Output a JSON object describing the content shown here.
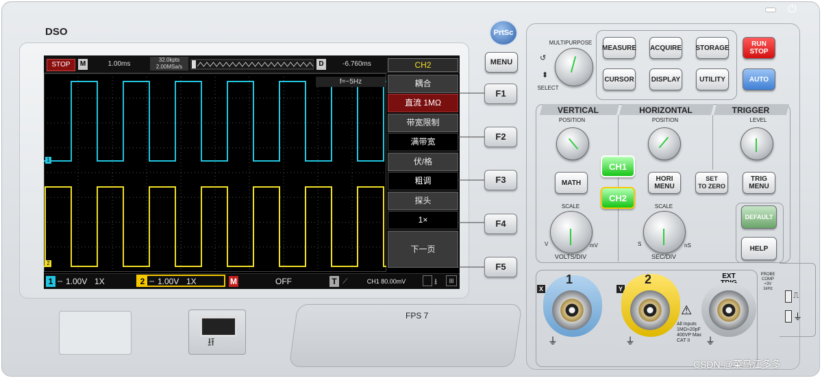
{
  "brand": "DSO",
  "screen": {
    "topbar": {
      "run_state": "STOP",
      "mode_badge": "M",
      "timebase": "1.00ms",
      "memory": "32.0kpts",
      "sample_rate": "2.00MSa/s",
      "delay_badge": "D",
      "delay": "-6.760ms",
      "channel_title": "CH2"
    },
    "freq_readout": "f=~5Hz",
    "menu": [
      {
        "label": "耦合",
        "value": "直流 1MΩ"
      },
      {
        "label": "带宽限制",
        "value": "满带宽"
      },
      {
        "label": "伏/格",
        "value": "粗调"
      },
      {
        "label": "探头",
        "value": "1×"
      },
      {
        "label": "下一页"
      }
    ],
    "markers": {
      "ch1": "1",
      "ch2": "2"
    },
    "bottombar": {
      "ch1_num": "1",
      "ch1_scale": "1.00V",
      "ch1_probe": "1X",
      "ch2_num": "2",
      "ch2_scale": "1.00V",
      "ch2_probe": "1X",
      "math_badge": "M",
      "math_state": "OFF",
      "trig_badge": "T",
      "trig_info": "CH1 80.00mV"
    },
    "colors": {
      "ch1": "#22c6e0",
      "ch2": "#f2e027",
      "ch2_badge": "#f7c800"
    }
  },
  "fps": "FPS 7",
  "softkeys": [
    "F1",
    "F2",
    "F3",
    "F4",
    "F5"
  ],
  "buttons": {
    "prtsc": "PrtSc",
    "menu": "MENU",
    "measure": "MEASURE",
    "acquire": "ACQUIRE",
    "storage": "STORAGE",
    "cursor": "CURSOR",
    "display": "DISPLAY",
    "utility": "UTILITY",
    "run_stop_1": "RUN",
    "run_stop_2": "STOP",
    "auto": "AUTO",
    "math": "MATH",
    "ch1": "CH1",
    "ch2": "CH2",
    "hori_menu_1": "HORI",
    "hori_menu_2": "MENU",
    "set_zero_1": "SET",
    "set_zero_2": "TO ZERO",
    "trig_menu_1": "TRIG",
    "trig_menu_2": "MENU",
    "default": "DEFAULT",
    "help": "HELP"
  },
  "panel": {
    "multipurpose": "MULTIPURPOSE",
    "select": "SELECT",
    "vertical": "VERTICAL",
    "horizontal": "HORIZONTAL",
    "trigger": "TRIGGER",
    "v_position": "POSITION",
    "h_position": "POSITION",
    "t_level": "LEVEL",
    "v_scale": "SCALE",
    "h_scale": "SCALE",
    "volts_div": "VOLTS/DIV",
    "sec_div": "SEC/DIV",
    "v_unit_left": "V",
    "v_unit_right": "mV",
    "s_unit_left": "S",
    "s_unit_right": "nS",
    "input_x": "X",
    "input_y": "Y",
    "bnc1": "1",
    "bnc2": "2",
    "ext_trig_1": "EXT",
    "ext_trig_2": "TRIG",
    "warning_lines": [
      "All Inputs",
      "1MΩ≈20pF",
      "400VP Max",
      "CAT II"
    ],
    "probe_comp": [
      "PROBE",
      "COMP",
      "≈3V",
      "1kHz"
    ]
  },
  "watermark": "CSDN @菜鸟江多多"
}
